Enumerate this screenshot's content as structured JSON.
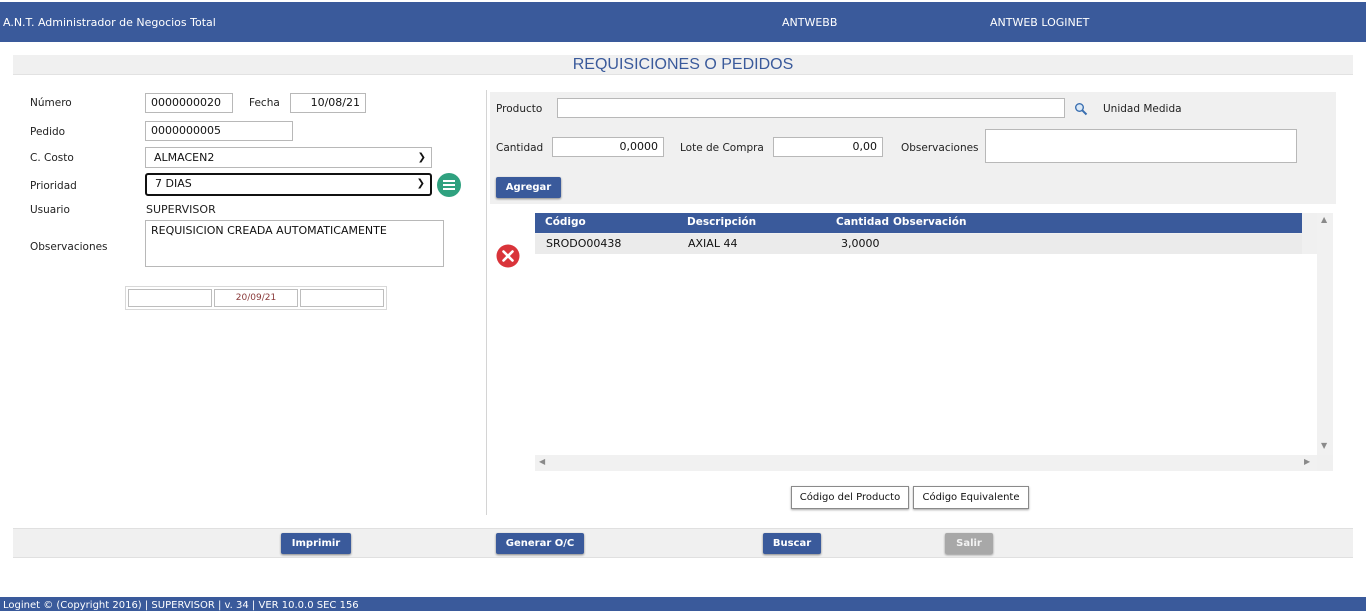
{
  "header": {
    "app_title": "A.N.T. Administrador de Negocios Total",
    "company": "ANTWEBB",
    "system": "ANTWEB LOGINET"
  },
  "page_title": "REQUISICIONES O PEDIDOS",
  "form": {
    "numero_label": "Número",
    "numero_value": "0000000020",
    "fecha_label": "Fecha",
    "fecha_value": "10/08/21",
    "pedido_label": "Pedido",
    "pedido_value": "0000000005",
    "costo_label": "C. Costo",
    "costo_value": "ALMACEN2",
    "prioridad_label": "Prioridad",
    "prioridad_value": "7 DIAS",
    "usuario_label": "Usuario",
    "usuario_value": "SUPERVISOR",
    "obs_label": "Observaciones",
    "obs_value": "REQUISICION CREADA AUTOMATICAMENTE",
    "date_fields": [
      "",
      "20/09/21",
      ""
    ]
  },
  "product_panel": {
    "producto_label": "Producto",
    "producto_value": "",
    "unidad_label": "Unidad Medida",
    "cantidad_label": "Cantidad",
    "cantidad_value": "0,0000",
    "lote_label": "Lote de Compra",
    "lote_value": "0,00",
    "obs_label": "Observaciones",
    "obs_value": "",
    "add_label": "Agregar"
  },
  "grid": {
    "columns": [
      "Código",
      "Descripción",
      "Cantidad",
      "Observación"
    ],
    "rows": [
      {
        "codigo": "SRODO00438",
        "descripcion": "AXIAL 44",
        "cantidad": "3,0000",
        "observacion": ""
      }
    ]
  },
  "lookup_buttons": {
    "codigo_producto": "Código del Producto",
    "codigo_equivalente": "Código Equivalente"
  },
  "actions": {
    "imprimir": "Imprimir",
    "generar": "Generar O/C",
    "buscar": "Buscar",
    "salir": "Salir"
  },
  "footer": "Loginet © (Copyright 2016) | SUPERVISOR | v. 34 | VER 10.0.0 SEC 156",
  "colors": {
    "header_blue": "#3a5a9b",
    "menu_green": "#2fa17f",
    "delete_red": "#d9343a"
  }
}
